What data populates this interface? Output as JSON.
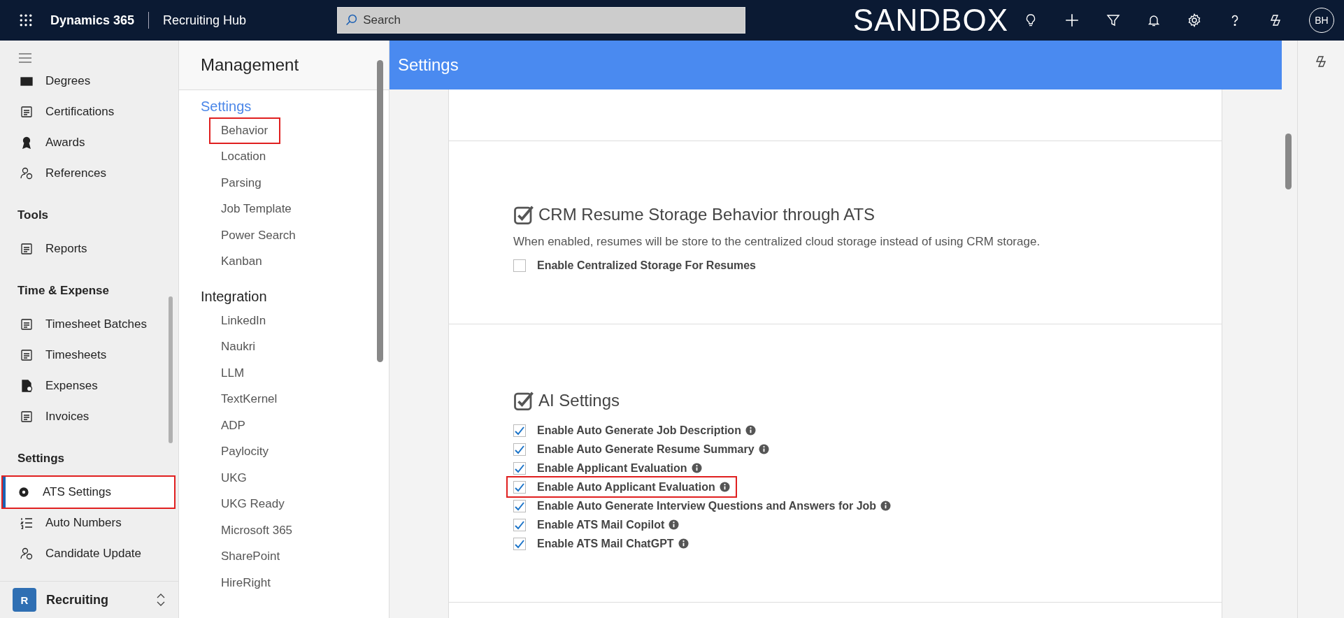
{
  "top_bar": {
    "app_name": "Dynamics 365",
    "area": "Recruiting Hub",
    "search": {
      "placeholder": "Search"
    },
    "environment": "SANDBOX",
    "avatar": "BH"
  },
  "sidebar": {
    "groups": [
      {
        "items": [
          {
            "label": "Degrees",
            "selected": false,
            "highlighted": false
          },
          {
            "label": "Certifications",
            "selected": false,
            "highlighted": false
          },
          {
            "label": "Awards",
            "selected": false,
            "highlighted": false
          },
          {
            "label": "References",
            "selected": false,
            "highlighted": false
          }
        ]
      },
      {
        "heading": "Tools",
        "items": [
          {
            "label": "Reports",
            "selected": false,
            "highlighted": false
          }
        ]
      },
      {
        "heading": "Time & Expense",
        "items": [
          {
            "label": "Timesheet Batches",
            "selected": false,
            "highlighted": false
          },
          {
            "label": "Timesheets",
            "selected": false,
            "highlighted": false
          },
          {
            "label": "Expenses",
            "selected": false,
            "highlighted": false
          },
          {
            "label": "Invoices",
            "selected": false,
            "highlighted": false
          }
        ]
      },
      {
        "heading": "Settings",
        "items": [
          {
            "label": "ATS Settings",
            "selected": true,
            "highlighted": true
          },
          {
            "label": "Auto Numbers",
            "selected": false,
            "highlighted": false
          },
          {
            "label": "Candidate Update",
            "selected": false,
            "highlighted": false
          }
        ]
      }
    ],
    "area_switcher": {
      "badge": "R",
      "label": "Recruiting"
    }
  },
  "management": {
    "title": "Management",
    "groups": [
      {
        "heading": "Settings",
        "active": true,
        "items": [
          {
            "label": "Behavior",
            "highlighted": true
          },
          {
            "label": "Location",
            "highlighted": false
          },
          {
            "label": "Parsing",
            "highlighted": false
          },
          {
            "label": "Job Template",
            "highlighted": false
          },
          {
            "label": "Power Search",
            "highlighted": false
          },
          {
            "label": "Kanban",
            "highlighted": false
          }
        ]
      },
      {
        "heading": "Integration",
        "active": false,
        "items": [
          {
            "label": "LinkedIn",
            "highlighted": false
          },
          {
            "label": "Naukri",
            "highlighted": false
          },
          {
            "label": "LLM",
            "highlighted": false
          },
          {
            "label": "TextKernel",
            "highlighted": false
          },
          {
            "label": "ADP",
            "highlighted": false
          },
          {
            "label": "Paylocity",
            "highlighted": false
          },
          {
            "label": "UKG",
            "highlighted": false
          },
          {
            "label": "UKG Ready",
            "highlighted": false
          },
          {
            "label": "Microsoft 365",
            "highlighted": false
          },
          {
            "label": "SharePoint",
            "highlighted": false
          },
          {
            "label": "HireRight",
            "highlighted": false
          }
        ]
      }
    ]
  },
  "settings": {
    "title": "Settings",
    "sections": [
      {
        "heading": "CRM Resume Storage Behavior through ATS",
        "checked": true,
        "description": "When enabled, resumes will be store to the centralized cloud storage instead of using CRM storage.",
        "options": [
          {
            "label": "Enable Centralized Storage For Resumes",
            "checked": false,
            "info": false,
            "highlighted": false
          }
        ]
      },
      {
        "heading": "AI Settings",
        "checked": true,
        "options": [
          {
            "label": "Enable Auto Generate Job Description",
            "checked": true,
            "info": true,
            "highlighted": false
          },
          {
            "label": "Enable Auto Generate Resume Summary",
            "checked": true,
            "info": true,
            "highlighted": false
          },
          {
            "label": "Enable Applicant Evaluation",
            "checked": true,
            "info": true,
            "highlighted": false
          },
          {
            "label": "Enable Auto Applicant Evaluation",
            "checked": true,
            "info": true,
            "highlighted": true
          },
          {
            "label": "Enable Auto Generate Interview Questions and Answers for Job",
            "checked": true,
            "info": true,
            "highlighted": false
          },
          {
            "label": "Enable ATS Mail Copilot",
            "checked": true,
            "info": true,
            "highlighted": false
          },
          {
            "label": "Enable ATS Mail ChatGPT",
            "checked": true,
            "info": true,
            "highlighted": false
          }
        ]
      }
    ]
  }
}
